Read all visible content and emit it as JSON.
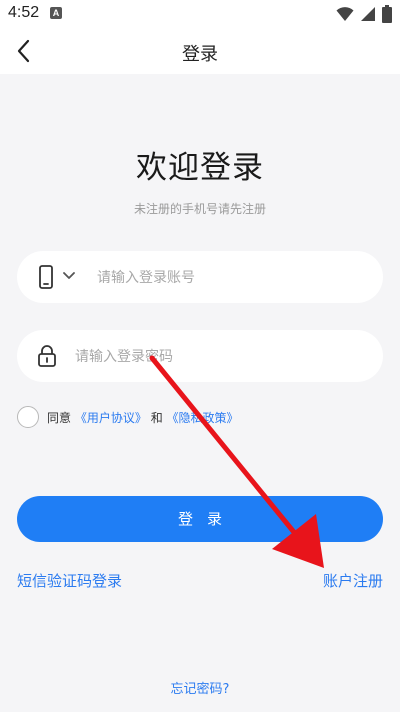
{
  "status_bar": {
    "time": "4:52",
    "notification_letter": "A",
    "icons": [
      "wifi-icon",
      "signal-icon",
      "battery-icon"
    ]
  },
  "header": {
    "title": "登录",
    "back_icon": "chevron-left-icon"
  },
  "main": {
    "title": "欢迎登录",
    "subtitle": "未注册的手机号请先注册"
  },
  "account_input": {
    "icon": "phone-icon",
    "dropdown_icon": "chevron-down-icon",
    "placeholder": "请输入登录账号",
    "value": ""
  },
  "password_input": {
    "icon": "lock-icon",
    "placeholder": "请输入登录密码",
    "value": ""
  },
  "agreement": {
    "checked": false,
    "prefix": "同意",
    "user_agreement": "《用户协议》",
    "and": "和",
    "privacy_policy": "《隐私政策》"
  },
  "login_button": {
    "label": "登录"
  },
  "links": {
    "sms_login": "短信验证码登录",
    "register": "账户注册",
    "forgot_password": "忘记密码?"
  },
  "colors": {
    "accent": "#1f7ef5",
    "link": "#2b7bf0",
    "background": "#f5f5f7",
    "annotation_arrow": "#e8141b"
  }
}
